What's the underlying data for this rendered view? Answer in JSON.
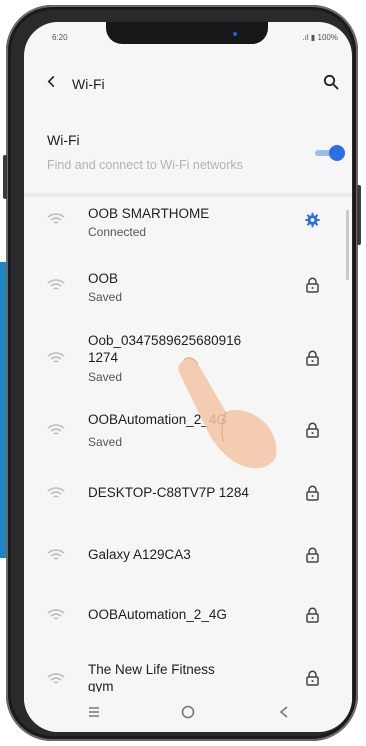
{
  "status_bar": {
    "time": "6:20",
    "battery": "100%"
  },
  "app_bar": {
    "title": "Wi-Fi",
    "back_icon": "back-arrow-icon",
    "search_icon": "search-icon"
  },
  "wifi_master": {
    "label": "Wi-Fi",
    "subtitle": "Find and connect to Wi-Fi networks",
    "enabled": true
  },
  "networks": [
    {
      "name": "OOB SMARTHOME",
      "status": "Connected",
      "action_icon": "settings-gear-icon"
    },
    {
      "name": "OOB",
      "status": "Saved",
      "action_icon": "lock-icon"
    },
    {
      "name": "Oob_0347589625680916\n1274",
      "status": "Saved",
      "action_icon": "lock-icon"
    },
    {
      "name": "OOBAutomation_2_4G",
      "status": "Saved",
      "action_icon": "lock-icon"
    },
    {
      "name": "DESKTOP-C88TV7P 1284",
      "status": "",
      "action_icon": "lock-icon"
    },
    {
      "name": "Galaxy A129CA3",
      "status": "",
      "action_icon": "lock-icon"
    },
    {
      "name": "OOBAutomation_2_4G",
      "status": "",
      "action_icon": "lock-icon"
    },
    {
      "name": "The New Life Fitness\ngym",
      "status": "",
      "action_icon": "lock-icon"
    }
  ],
  "nav_bar": {
    "recents_icon": "recents-icon",
    "home_icon": "home-icon",
    "back_icon": "nav-back-icon"
  },
  "colors": {
    "accent": "#2b6fe0",
    "toggle_track": "#9bbcf0",
    "screen_bg": "#f6f6f6",
    "side_stripe": "#1e86c4"
  }
}
